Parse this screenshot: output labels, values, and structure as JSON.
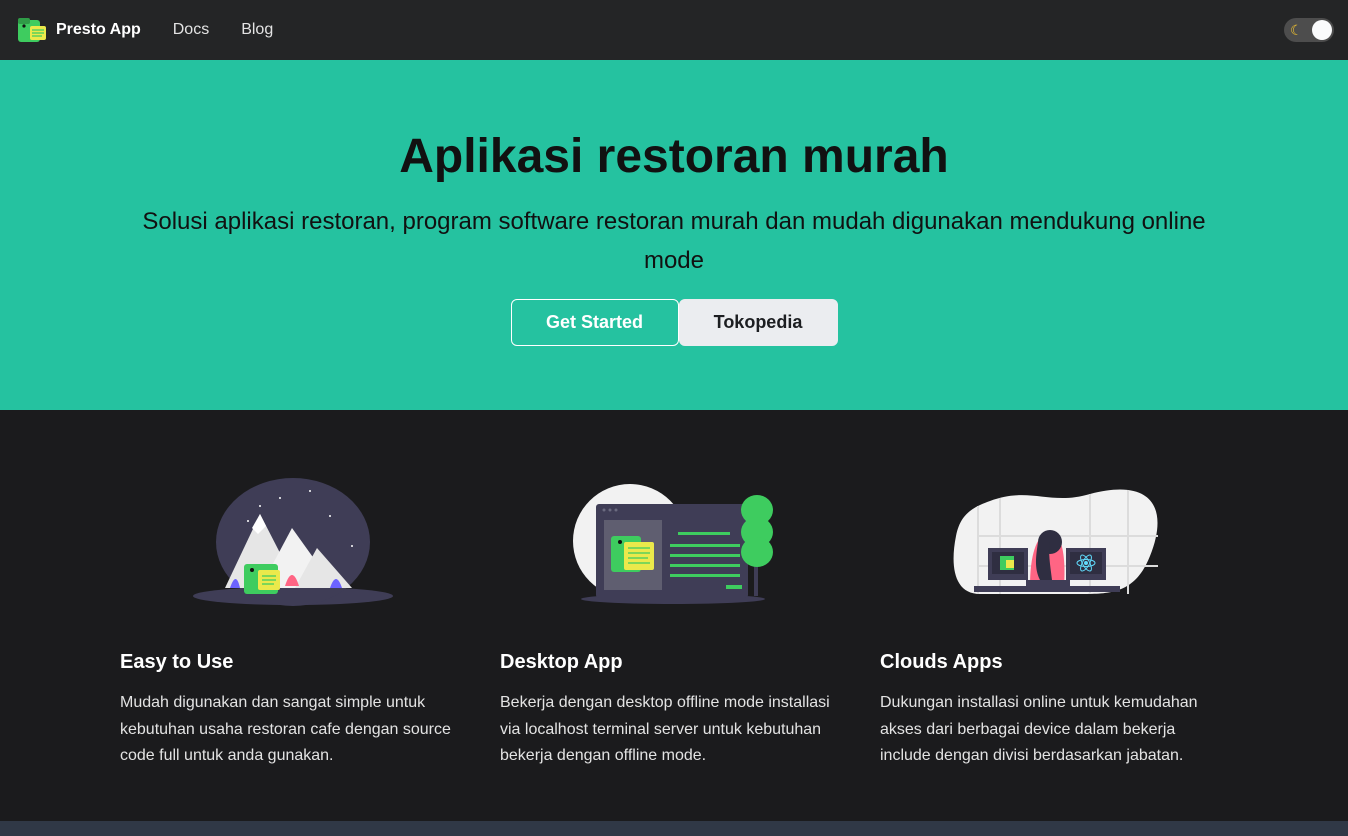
{
  "navbar": {
    "brand_title": "Presto App",
    "links": [
      "Docs",
      "Blog"
    ],
    "theme_toggle": {
      "icon": "moon-icon",
      "state": "dark"
    }
  },
  "hero": {
    "title": "Aplikasi restoran murah",
    "subtitle": "Solusi aplikasi restoran, program software restoran murah dan mudah digunakan mendukung online mode",
    "primary_button": "Get Started",
    "secondary_button": "Tokopedia",
    "background_color": "#25c2a0"
  },
  "features": [
    {
      "title": "Easy to Use",
      "text": "Mudah digunakan dan sangat simple untuk kebutuhan usaha restoran cafe dengan source code full untuk anda gunakan.",
      "illustration": "mountain-dino-illustration"
    },
    {
      "title": "Desktop App",
      "text": "Bekerja dengan desktop offline mode installasi via localhost terminal server untuk kebutuhan bekerja dengan offline mode.",
      "illustration": "desktop-window-illustration"
    },
    {
      "title": "Clouds Apps",
      "text": "Dukungan installasi online untuk kemudahan akses dari berbagai device dalam bekerja include dengan divisi berdasarkan jabatan.",
      "illustration": "person-monitors-illustration"
    }
  ],
  "colors": {
    "navbar_bg": "#242526",
    "page_bg": "#1b1b1d",
    "accent": "#25c2a0"
  }
}
